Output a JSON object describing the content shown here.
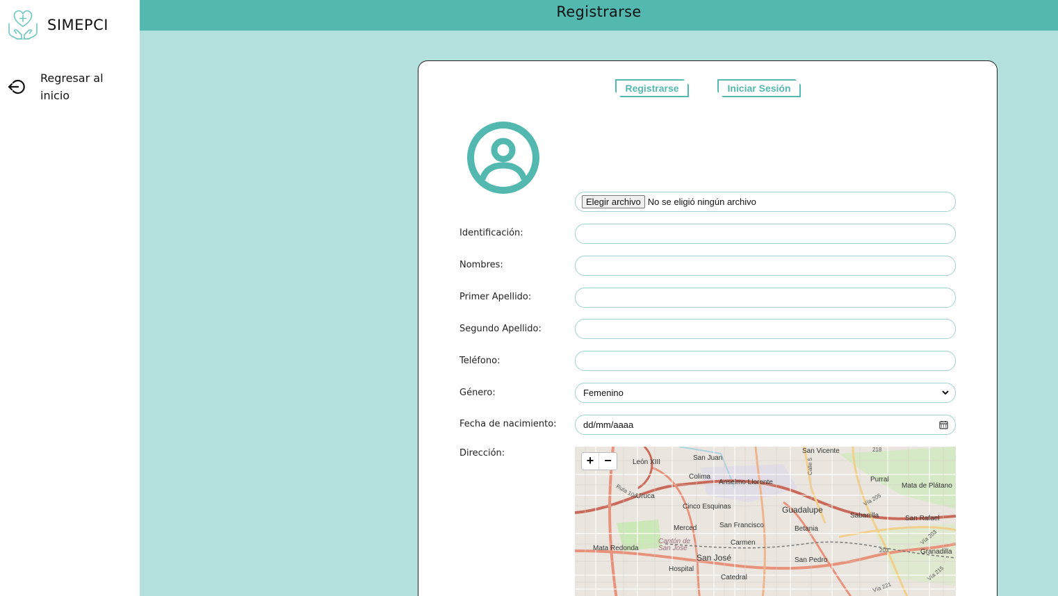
{
  "app": {
    "name": "SIMEPCI",
    "logo_icon": "hands-heart-icon"
  },
  "sidebar": {
    "back_label": "Regresar al inicio",
    "back_icon": "sign-out-icon"
  },
  "header": {
    "title": "Registrarse"
  },
  "tabs": {
    "register": "Registrarse",
    "login": "Iniciar Sesión"
  },
  "form": {
    "file_button": "Elegir archivo",
    "file_status": "No se eligió ningún archivo",
    "labels": {
      "identification": "Identificación:",
      "names": "Nombres:",
      "first_surname": "Primer Apellido:",
      "second_surname": "Segundo Apellido:",
      "phone": "Teléfono:",
      "gender": "Género:",
      "birthdate": "Fecha de nacimiento:",
      "address": "Dirección:"
    },
    "values": {
      "identification": "",
      "names": "",
      "first_surname": "",
      "second_surname": "",
      "phone": "",
      "gender": "Femenino",
      "birthdate": "dd/mm/aaaa"
    }
  },
  "map": {
    "zoom_in": "+",
    "zoom_out": "−",
    "places": [
      "San Juan",
      "San Vicente",
      "León XIII",
      "Colima",
      "Anselmo Llorente",
      "Purral",
      "Mata de Plátano",
      "Uruca",
      "Cinco Esquinas",
      "Guadalupe",
      "Sabanilla",
      "San Rafael",
      "Merced",
      "San Francisco",
      "Betania",
      "Cantón de San José",
      "Carmen",
      "Mata Redonda",
      "San José",
      "San Pedro",
      "Granadilla",
      "Hospital",
      "Catedral"
    ],
    "roads": [
      "218",
      "Calle 5",
      "Ruta 108",
      "Vía 205",
      "Vía 203",
      "203",
      "Vía 221",
      "Vía 215"
    ],
    "colors": {
      "road_major": "#e8927c",
      "road_trunk": "#c96a5a",
      "park": "#cde8b8",
      "water": "#aad3df"
    }
  },
  "colors": {
    "accent": "#52b8b0",
    "background": "#b3dfdc"
  }
}
